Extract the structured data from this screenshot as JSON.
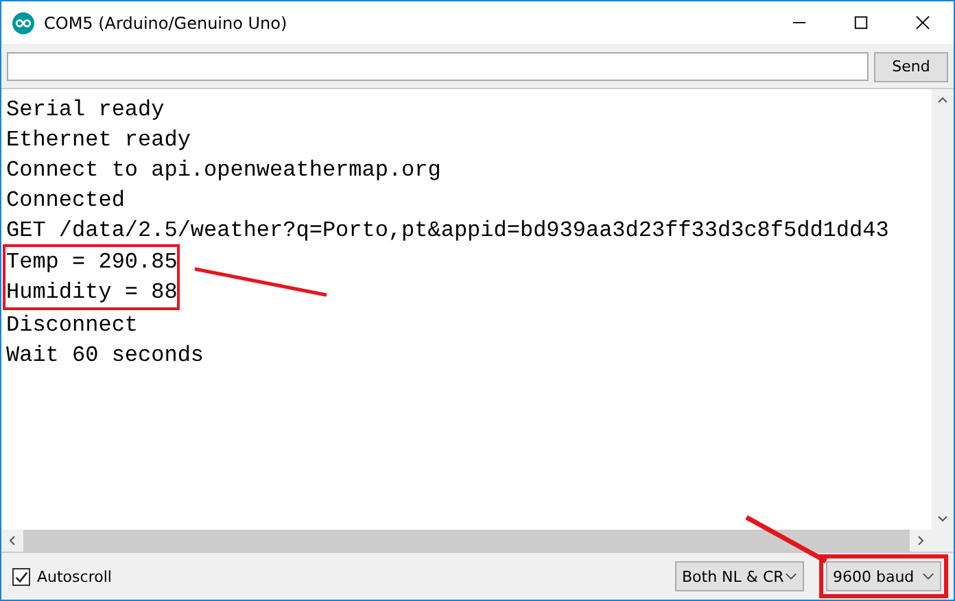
{
  "window": {
    "title": "COM5 (Arduino/Genuino Uno)"
  },
  "send": {
    "label": "Send"
  },
  "output": [
    {
      "highlighted": false,
      "lines": [
        "Serial ready",
        "Ethernet ready",
        "Connect to api.openweathermap.org",
        "Connected",
        "GET /data/2.5/weather?q=Porto,pt&appid=bd939aa3d23ff33d3c8f5dd1dd43"
      ]
    },
    {
      "highlighted": true,
      "lines": [
        "Temp = 290.85",
        "Humidity = 88"
      ]
    },
    {
      "highlighted": false,
      "lines": [
        "Disconnect",
        "Wait 60 seconds"
      ]
    }
  ],
  "autoscroll": {
    "label": "Autoscroll",
    "checked": true
  },
  "line_ending": {
    "value": "Both NL & CR",
    "highlighted": false
  },
  "baud": {
    "value": "9600 baud",
    "highlighted": true
  }
}
